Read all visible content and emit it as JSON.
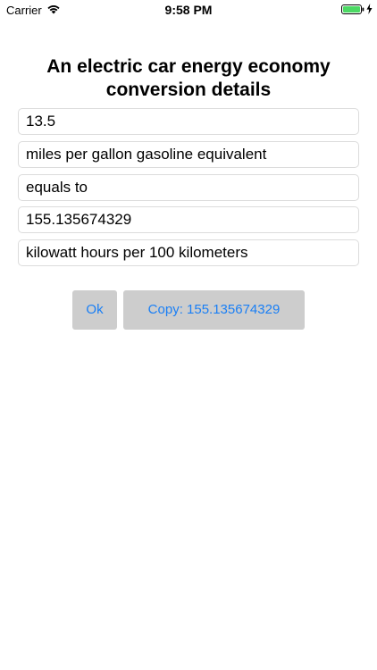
{
  "status_bar": {
    "carrier": "Carrier",
    "time": "9:58 PM"
  },
  "title": "An electric car energy economy conversion details",
  "fields": {
    "input_value": "13.5",
    "from_unit": "miles per gallon gasoline equivalent",
    "equals_label": "equals to",
    "result_value": "155.135674329",
    "to_unit": "kilowatt hours per 100 kilometers"
  },
  "buttons": {
    "ok_label": "Ok",
    "copy_label": "Copy: 155.135674329"
  },
  "colors": {
    "accent": "#1a7ff5",
    "button_bg": "#cdcdcd",
    "battery": "#4cd964"
  },
  "icons": {
    "wifi": "wifi-icon",
    "battery": "battery-icon",
    "charging": "charging-bolt-icon"
  }
}
